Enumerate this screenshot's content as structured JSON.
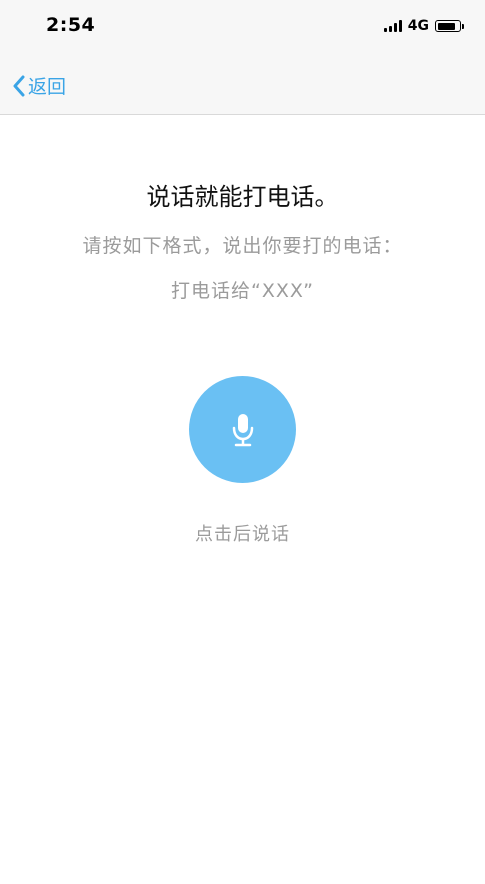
{
  "status_bar": {
    "time": "2:54",
    "network": "4G",
    "battery_level": 0.85,
    "icons": [
      "signal-icon",
      "battery-icon"
    ]
  },
  "nav": {
    "back_label": "返回",
    "back_icon": "chevron-left-icon"
  },
  "content": {
    "title": "说话就能打电话。",
    "instruction": "请按如下格式，说出你要打的电话：",
    "example": "打电话给“XXX”",
    "mic_icon": "microphone-icon",
    "hint": "点击后说话"
  },
  "colors": {
    "accent": "#3aa4e6",
    "mic_button": "#6ac0f3",
    "secondary_text": "#9b9b9b",
    "bar_background": "#f7f7f7"
  }
}
